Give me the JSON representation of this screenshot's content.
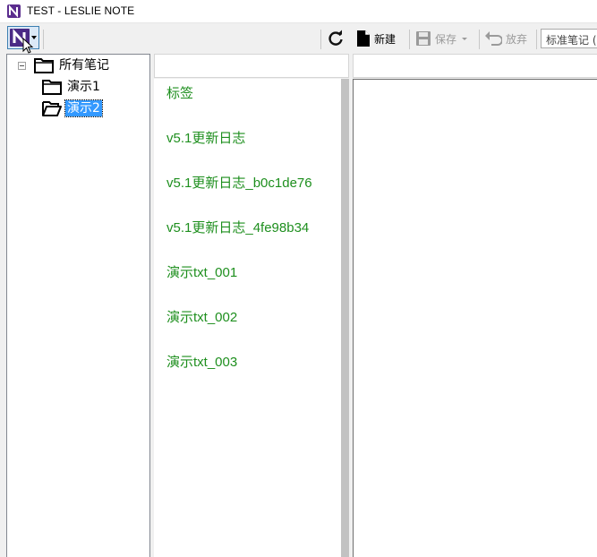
{
  "window": {
    "title": "TEST - LESLIE NOTE",
    "app_icon": "leslie-note-logo"
  },
  "toolbar": {
    "refresh_icon": "refresh-icon",
    "new_label": "新建",
    "save_label": "保存",
    "discard_label": "放弃",
    "style_select_value": "标准笔记 ("
  },
  "tree": {
    "root": {
      "label": "所有笔记",
      "icon": "folder-icon",
      "expanded": true
    },
    "children": [
      {
        "label": "演示1",
        "icon": "folder-icon",
        "selected": false
      },
      {
        "label": "演示2",
        "icon": "folder-open-icon",
        "selected": true
      }
    ]
  },
  "notes": {
    "items": [
      "标签",
      "v5.1更新日志",
      "v5.1更新日志_b0c1de76",
      "v5.1更新日志_4fe98b34",
      "演示txt_001",
      "演示txt_002",
      "演示txt_003"
    ]
  },
  "colors": {
    "note_text": "#1e8f1e",
    "selection": "#3399ff",
    "brand": "#4a2a85"
  }
}
